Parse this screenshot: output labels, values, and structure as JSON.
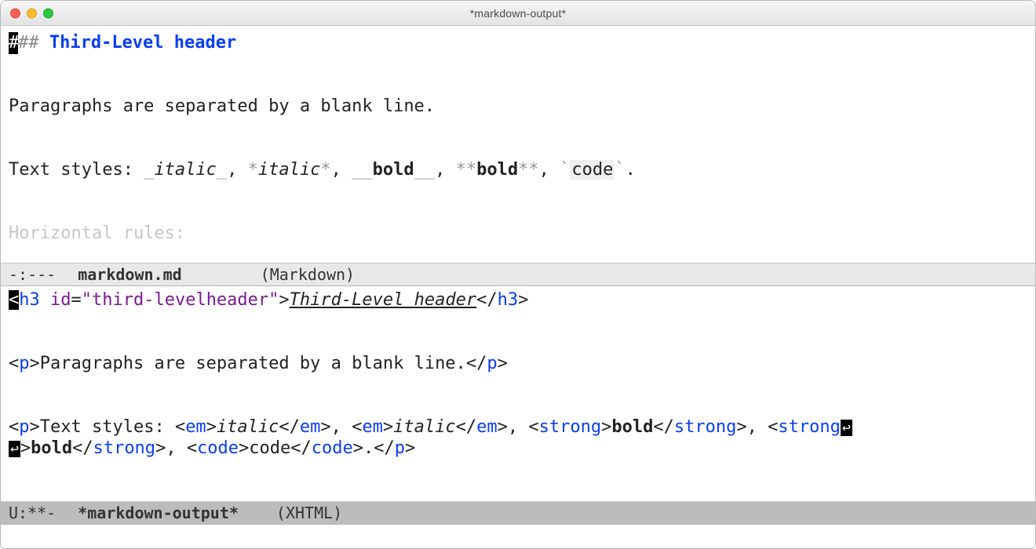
{
  "window": {
    "title": "*markdown-output*"
  },
  "top": {
    "cursor_char": "#",
    "hash_rest": "##",
    "heading_text": "Third-Level header",
    "para": "Paragraphs are separated by a blank line.",
    "styles_prefix": "Text styles: ",
    "italic_u": "italic",
    "italic_s": "italic",
    "bold_u": "bold",
    "bold_s": "bold",
    "code_word": "code",
    "period": ".",
    "hr_partial": "Horizontal rules:",
    "markers": {
      "u": "_",
      "uu": "__",
      "s": "*",
      "ss": "**",
      "bt": "`"
    }
  },
  "modeline_top": {
    "flags": "-:---",
    "name": "markdown.md",
    "mode": "(Markdown)"
  },
  "bot": {
    "h3_open_tag": "h3",
    "h3_open_sp": " ",
    "h3_id_attr": "id",
    "h3_id_eq": "=",
    "h3_id_val": "\"third-levelheader\"",
    "h3_text": "Third-Level header",
    "h3_close_tag": "h3",
    "p1_open": "p",
    "p1_text": "Paragraphs are separated by a blank line.",
    "p1_close": "p",
    "p2_open": "p",
    "p2_prefix": "Text styles: ",
    "em": "em",
    "em_close": "em",
    "em_text": "italic",
    "sep": ", ",
    "strong": "strong",
    "strong_close": "strong",
    "strong_text": "bold",
    "code": "code",
    "code_close": "code",
    "code_text": "code",
    "p2_close": "p",
    "wrap_cont": ">",
    "period": "."
  },
  "modeline_bot": {
    "flags": "U:**-",
    "name": "*markdown-output*",
    "mode": "(XHTML)"
  },
  "glyphs": {
    "lt": "<",
    "gt": ">",
    "sl": "/",
    "wr": "↩"
  }
}
